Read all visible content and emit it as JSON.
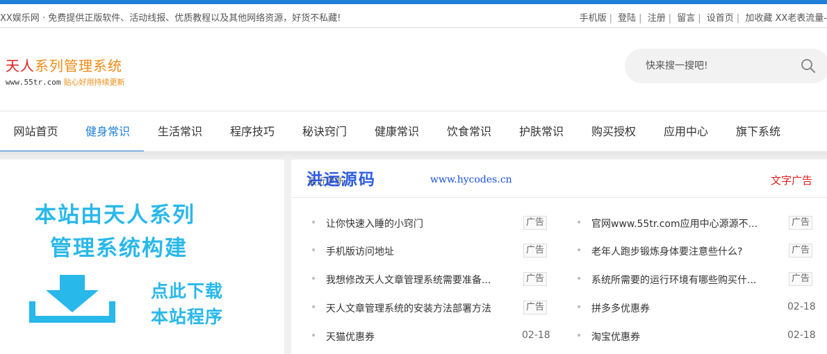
{
  "topbar": {
    "notice": "XX娱乐网 · 免费提供正版软件、活动线报、优质教程以及其他网络资源，好货不私藏!",
    "links": [
      "手机版",
      "登陆",
      "注册",
      "留言",
      "设首页",
      "加收藏",
      "XX老表流量-"
    ]
  },
  "logo": {
    "title_red": "天人",
    "title_orange": "系列管理系统",
    "url": "www.55tr.com",
    "tagline": "贴心好用持续更新"
  },
  "search": {
    "placeholder": "快来搜一搜吧!"
  },
  "nav": {
    "items": [
      "网站首页",
      "健身常识",
      "生活常识",
      "程序技巧",
      "秘诀窍门",
      "健康常识",
      "饮食常识",
      "护肤常识",
      "购买授权",
      "应用中心",
      "旗下系统"
    ],
    "active": "健身常识"
  },
  "banner": {
    "line1": "本站由天人系列",
    "line2": "管理系统构建",
    "cta1": "点此下载",
    "cta2": "本站程序"
  },
  "news": {
    "heading": "最近更新",
    "watermark": "洪运源码",
    "watermark_url": "www.hycodes.cn",
    "ad_link": "文字广告",
    "left": [
      {
        "title": "让你快速入睡的小窍门",
        "badge": "广告"
      },
      {
        "title": "手机版访问地址",
        "badge": "广告"
      },
      {
        "title": "我想修改天人文章管理系统需要准备...",
        "badge": "广告"
      },
      {
        "title": "天人文章管理系统的安装方法部署方法",
        "badge": "广告"
      },
      {
        "title": "天猫优惠券",
        "date": "02-18"
      }
    ],
    "right": [
      {
        "title": "官网www.55tr.com应用中心源源不...",
        "badge": "广告"
      },
      {
        "title": "老年人跑步锻炼身体要注意些什么?",
        "badge": "广告"
      },
      {
        "title": "系统所需要的运行环境有哪些购买什...",
        "badge": "广告"
      },
      {
        "title": "拼多多优惠券",
        "date": "02-18"
      },
      {
        "title": "淘宝优惠券",
        "date": "02-18"
      }
    ]
  },
  "colors": {
    "accent": "#1e7fd6",
    "red": "#e0201d",
    "orange": "#f08a14",
    "banner": "#29b8ea"
  }
}
